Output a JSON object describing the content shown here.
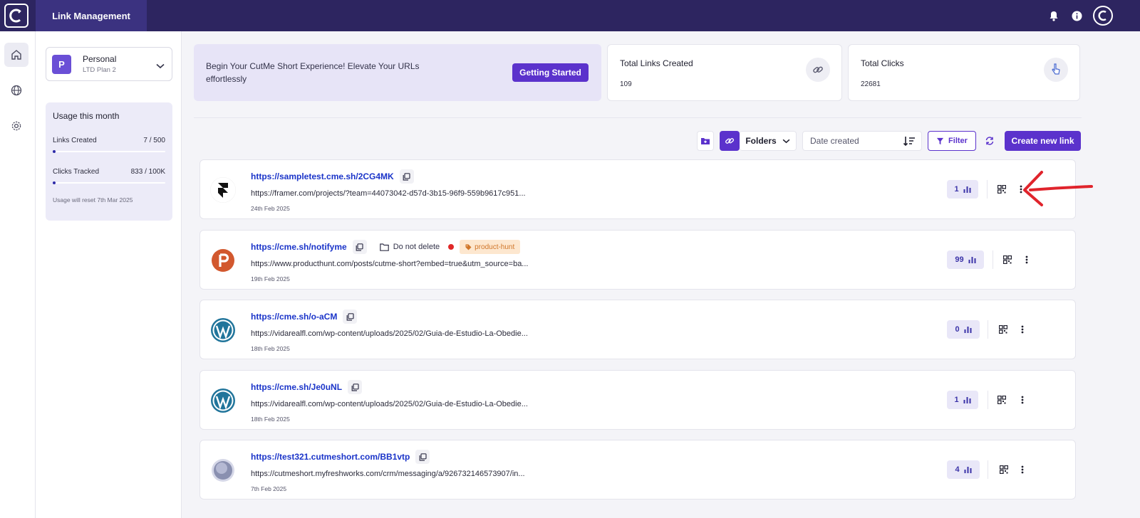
{
  "app": {
    "title": "Link Management",
    "brand_color": "#2d2560",
    "accent_color": "#5b32cc",
    "icons": [
      "cutme-logo-icon",
      "bell-icon",
      "info-icon",
      "user-avatar"
    ]
  },
  "rail": {
    "items": [
      {
        "icon": "home-icon",
        "active": true
      },
      {
        "icon": "globe-icon",
        "active": false
      },
      {
        "icon": "gear-icon",
        "active": false
      }
    ]
  },
  "workspace": {
    "badge": "P",
    "name": "Personal",
    "plan": "LTD Plan 2"
  },
  "usage": {
    "title": "Usage this month",
    "links_label": "Links Created",
    "links_value": "7 / 500",
    "links_fraction": 0.014,
    "clicks_label": "Clicks Tracked",
    "clicks_value": "833 / 100K",
    "clicks_fraction": 0.008,
    "reset_text": "Usage will reset 7th Mar 2025"
  },
  "banner": {
    "text": "Begin Your CutMe Short Experience! Elevate Your URLs effortlessly",
    "button": "Getting Started"
  },
  "stats": [
    {
      "title": "Total Links Created",
      "value": "109",
      "icon": "link-icon"
    },
    {
      "title": "Total Clicks",
      "value": "22681",
      "icon": "pointer-icon"
    }
  ],
  "toolbar": {
    "folders_label": "Folders",
    "sort_placeholder": "Date created",
    "filter_label": "Filter",
    "create_label": "Create new link"
  },
  "links": [
    {
      "short": "https://sampletest.cme.sh/2CG4MK",
      "long": "https://framer.com/projects/?team=44073042-d57d-3b15-96f9-559b9617c951...",
      "date": "24th Feb 2025",
      "clicks": "1",
      "favicon": "framer-icon",
      "folder": "",
      "tag": ""
    },
    {
      "short": "https://cme.sh/notifyme",
      "long": "https://www.producthunt.com/posts/cutme-short?embed=true&utm_source=ba...",
      "date": "19th Feb 2025",
      "clicks": "99",
      "favicon": "producthunt-icon",
      "folder": "Do not delete",
      "tag": "product-hunt"
    },
    {
      "short": "https://cme.sh/o-aCM",
      "long": "https://vidarealfl.com/wp-content/uploads/2025/02/Guia-de-Estudio-La-Obedie...",
      "date": "18th Feb 2025",
      "clicks": "0",
      "favicon": "wordpress-icon",
      "folder": "",
      "tag": ""
    },
    {
      "short": "https://cme.sh/Je0uNL",
      "long": "https://vidarealfl.com/wp-content/uploads/2025/02/Guia-de-Estudio-La-Obedie...",
      "date": "18th Feb 2025",
      "clicks": "1",
      "favicon": "wordpress-icon",
      "folder": "",
      "tag": ""
    },
    {
      "short": "https://test321.cutmeshort.com/BB1vtp",
      "long": "https://cutmeshort.myfreshworks.com/crm/messaging/a/926732146573907/in...",
      "date": "7th Feb 2025",
      "clicks": "4",
      "favicon": "globe-icon",
      "folder": "",
      "tag": ""
    }
  ],
  "annotation": {
    "icon": "red-arrow-icon",
    "color": "#e0242c"
  }
}
